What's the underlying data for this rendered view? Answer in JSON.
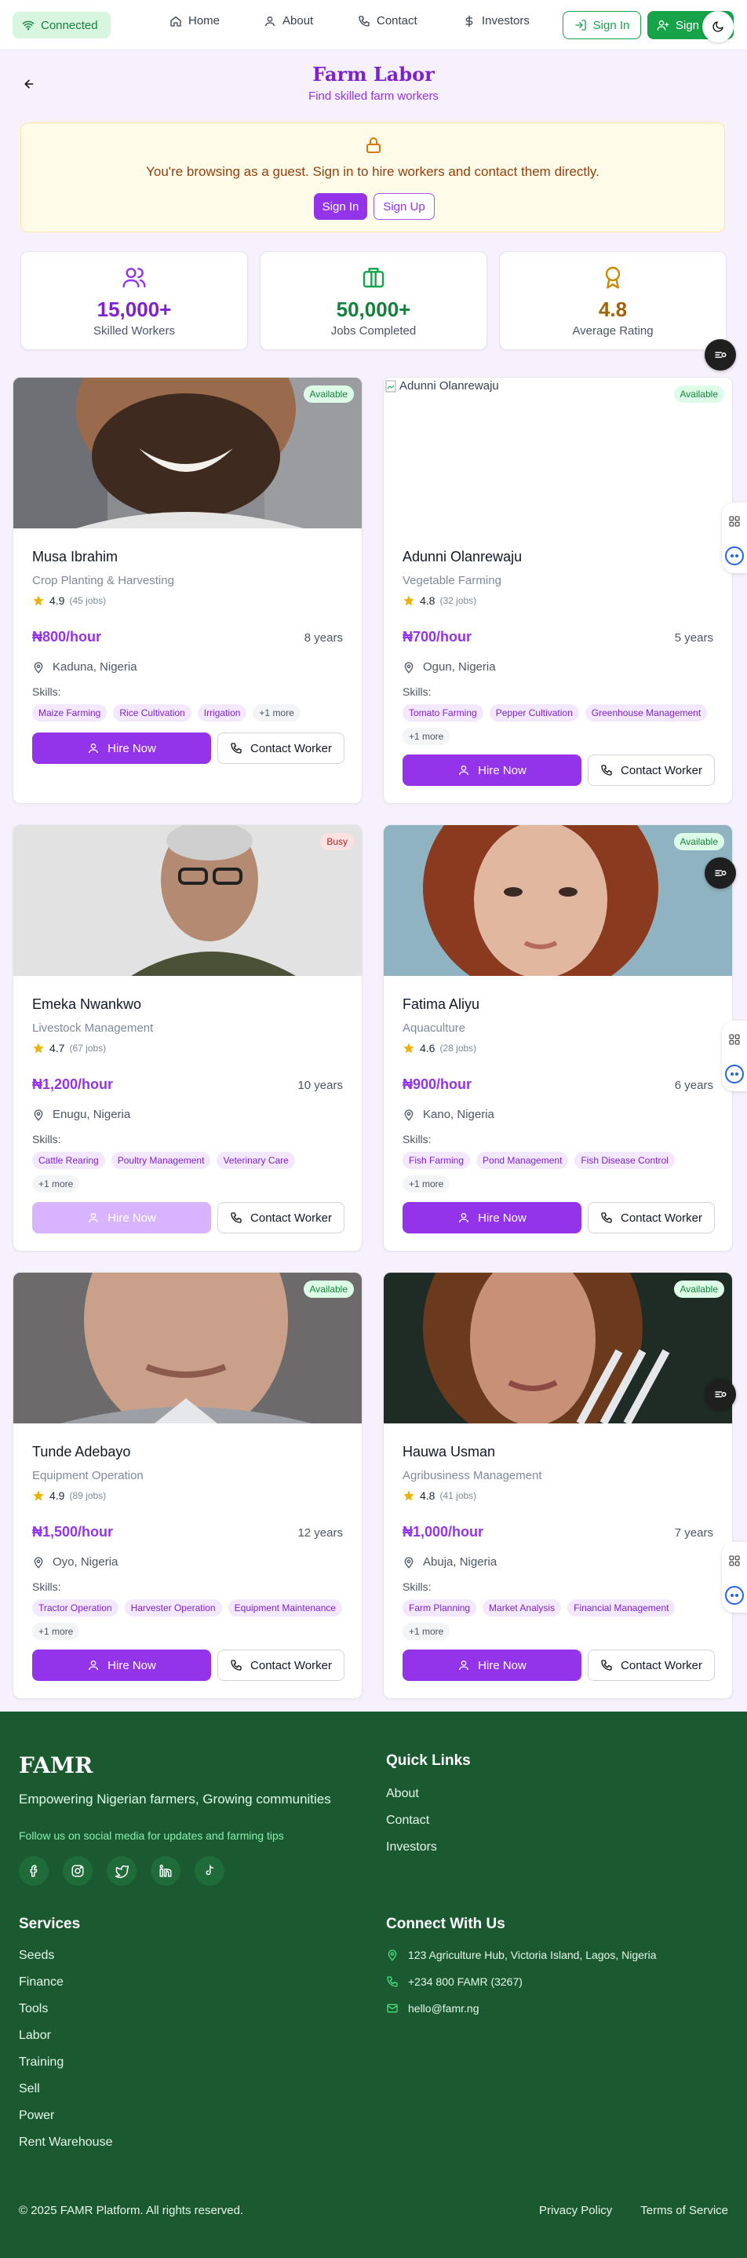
{
  "header": {
    "status": "Connected",
    "nav": [
      {
        "label": "Home",
        "icon": "home-icon"
      },
      {
        "label": "About",
        "icon": "user-icon"
      },
      {
        "label": "Contact",
        "icon": "phone-icon"
      },
      {
        "label": "Investors",
        "icon": "dollar-icon"
      }
    ],
    "sign_in": "Sign In",
    "sign_up": "Sign Up"
  },
  "page": {
    "title": "Farm Labor",
    "subtitle": "Find skilled farm workers"
  },
  "guest_banner": {
    "text": "You're browsing as a guest. Sign in to hire workers and contact them directly.",
    "sign_in": "Sign In",
    "sign_up": "Sign Up"
  },
  "stats": [
    {
      "value": "15,000+",
      "label": "Skilled Workers",
      "icon": "users-icon",
      "color": "#7e22ce"
    },
    {
      "value": "50,000+",
      "label": "Jobs Completed",
      "icon": "briefcase-icon",
      "color": "#15803d"
    },
    {
      "value": "4.8",
      "label": "Average Rating",
      "icon": "award-icon",
      "color": "#a16207"
    }
  ],
  "workers": [
    {
      "name": "Musa Ibrahim",
      "role": "Crop Planting & Harvesting",
      "rating": "4.9",
      "jobs": "(45 jobs)",
      "rate": "₦800/hour",
      "years": "8 years",
      "location": "Kaduna, Nigeria",
      "status": "Available",
      "skills": [
        "Maize Farming",
        "Rice Cultivation",
        "Irrigation",
        "+1 more"
      ],
      "hire": "Hire Now",
      "contact": "Contact Worker"
    },
    {
      "name": "Adunni Olanrewaju",
      "role": "Vegetable Farming",
      "rating": "4.8",
      "jobs": "(32 jobs)",
      "rate": "₦700/hour",
      "years": "5 years",
      "location": "Ogun, Nigeria",
      "status": "Available",
      "alt": "Adunni Olanrewaju",
      "skills": [
        "Tomato Farming",
        "Pepper Cultivation",
        "Greenhouse Management",
        "+1 more"
      ],
      "hire": "Hire Now",
      "contact": "Contact Worker"
    },
    {
      "name": "Emeka Nwankwo",
      "role": "Livestock Management",
      "rating": "4.7",
      "jobs": "(67 jobs)",
      "rate": "₦1,200/hour",
      "years": "10 years",
      "location": "Enugu, Nigeria",
      "status": "Busy",
      "skills": [
        "Cattle Rearing",
        "Poultry Management",
        "Veterinary Care",
        "+1 more"
      ],
      "hire": "Hire Now",
      "contact": "Contact Worker"
    },
    {
      "name": "Fatima Aliyu",
      "role": "Aquaculture",
      "rating": "4.6",
      "jobs": "(28 jobs)",
      "rate": "₦900/hour",
      "years": "6 years",
      "location": "Kano, Nigeria",
      "status": "Available",
      "skills": [
        "Fish Farming",
        "Pond Management",
        "Fish Disease Control",
        "+1 more"
      ],
      "hire": "Hire Now",
      "contact": "Contact Worker"
    },
    {
      "name": "Tunde Adebayo",
      "role": "Equipment Operation",
      "rating": "4.9",
      "jobs": "(89 jobs)",
      "rate": "₦1,500/hour",
      "years": "12 years",
      "location": "Oyo, Nigeria",
      "status": "Available",
      "skills": [
        "Tractor Operation",
        "Harvester Operation",
        "Equipment Maintenance",
        "+1 more"
      ],
      "hire": "Hire Now",
      "contact": "Contact Worker"
    },
    {
      "name": "Hauwa Usman",
      "role": "Agribusiness Management",
      "rating": "4.8",
      "jobs": "(41 jobs)",
      "rate": "₦1,000/hour",
      "years": "7 years",
      "location": "Abuja, Nigeria",
      "status": "Available",
      "skills": [
        "Farm Planning",
        "Market Analysis",
        "Financial Management",
        "+1 more"
      ],
      "hire": "Hire Now",
      "contact": "Contact Worker"
    }
  ],
  "footer": {
    "logo": "FAMR",
    "tagline": "Empowering Nigerian farmers, Growing communities",
    "follow": "Follow us on social media for updates and farming tips",
    "social": [
      "facebook-icon",
      "instagram-icon",
      "twitter-icon",
      "linkedin-icon",
      "tiktok-icon"
    ],
    "quick_links_title": "Quick Links",
    "quick_links": [
      "About",
      "Contact",
      "Investors"
    ],
    "services_title": "Services",
    "services": [
      "Seeds",
      "Finance",
      "Tools",
      "Labor",
      "Training",
      "Sell",
      "Power",
      "Rent Warehouse"
    ],
    "connect_title": "Connect With Us",
    "address": "123 Agriculture Hub, Victoria Island, Lagos, Nigeria",
    "phone": "+234 800 FAMR (3267)",
    "email": "hello@famr.ng",
    "copyright": "© 2025 FAMR Platform. All rights reserved.",
    "privacy": "Privacy Policy",
    "terms": "Terms of Service"
  },
  "colors": {
    "accent": "#9333ea",
    "green": "#16a34a",
    "footer": "#1b5a31"
  }
}
